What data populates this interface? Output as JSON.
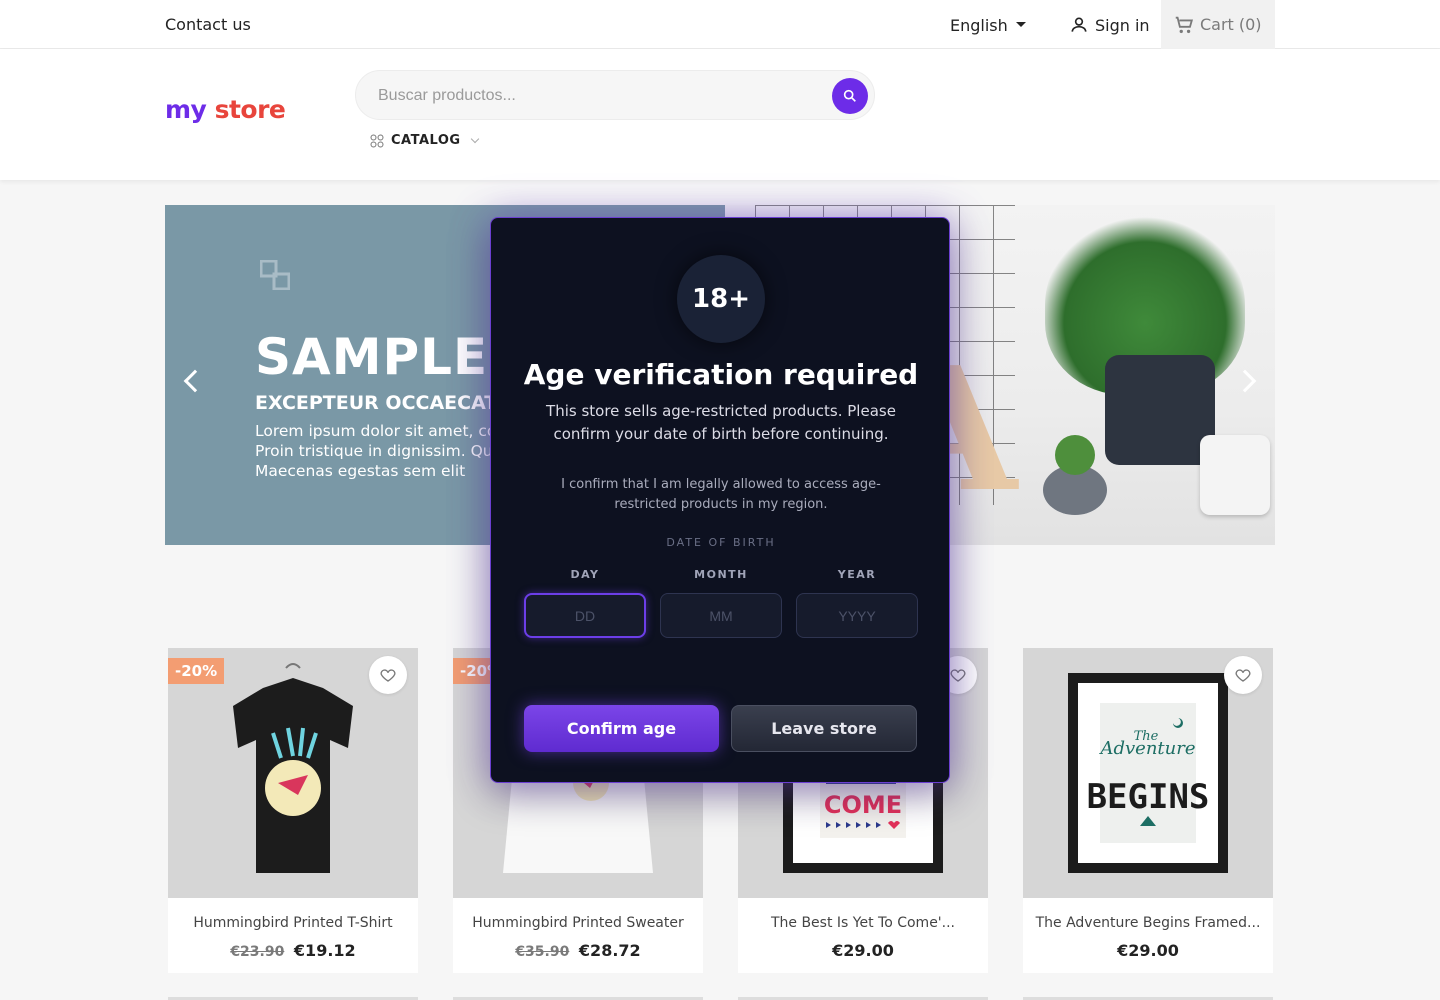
{
  "topbar": {
    "contact": "Contact us",
    "language": "English",
    "signin": "Sign in",
    "cart_label": "Cart",
    "cart_count": "(0)"
  },
  "header": {
    "logo_part1": "my",
    "logo_part2": "store",
    "search_placeholder": "Buscar productos...",
    "catalog": "CATALOG"
  },
  "slider": {
    "title": "SAMPLE 1",
    "subtitle": "EXCEPTEUR OCCAECAT",
    "text": "Lorem ipsum dolor sit amet, co adipiscing elit. Proin tristique in dignissim. Quisque non tempor Maecenas egestas sem elit"
  },
  "modal": {
    "badge": "18+",
    "title": "Age verification required",
    "description": "This store sells age-restricted products. Please confirm your date of birth before continuing.",
    "confirm_text": "I confirm that I am legally allowed to access age-restricted products in my region.",
    "dob_label": "DATE OF BIRTH",
    "day_label": "DAY",
    "month_label": "MONTH",
    "year_label": "YEAR",
    "day_placeholder": "DD",
    "month_placeholder": "MM",
    "year_placeholder": "YYYY",
    "confirm_button": "Confirm age",
    "leave_button": "Leave store"
  },
  "products": [
    {
      "name": "Hummingbird Printed T-Shirt",
      "old_price": "€23.90",
      "price": "€19.12",
      "badge": "-20%"
    },
    {
      "name": "Hummingbird Printed Sweater",
      "old_price": "€35.90",
      "price": "€28.72",
      "badge": "-20%"
    },
    {
      "name": "The Best Is Yet To Come'...",
      "old_price": "",
      "price": "€29.00",
      "badge": "",
      "poster_text": "COME"
    },
    {
      "name": "The Adventure Begins Framed...",
      "old_price": "",
      "price": "€29.00",
      "badge": "",
      "poster_line1": "The",
      "poster_line2": "Adventure",
      "poster_line3": "BEGINS"
    }
  ],
  "colors": {
    "accent": "#6d2ce8",
    "badge": "#f39d72",
    "slider_bg": "#7a98a6",
    "modal_bg": "#0d1120"
  }
}
